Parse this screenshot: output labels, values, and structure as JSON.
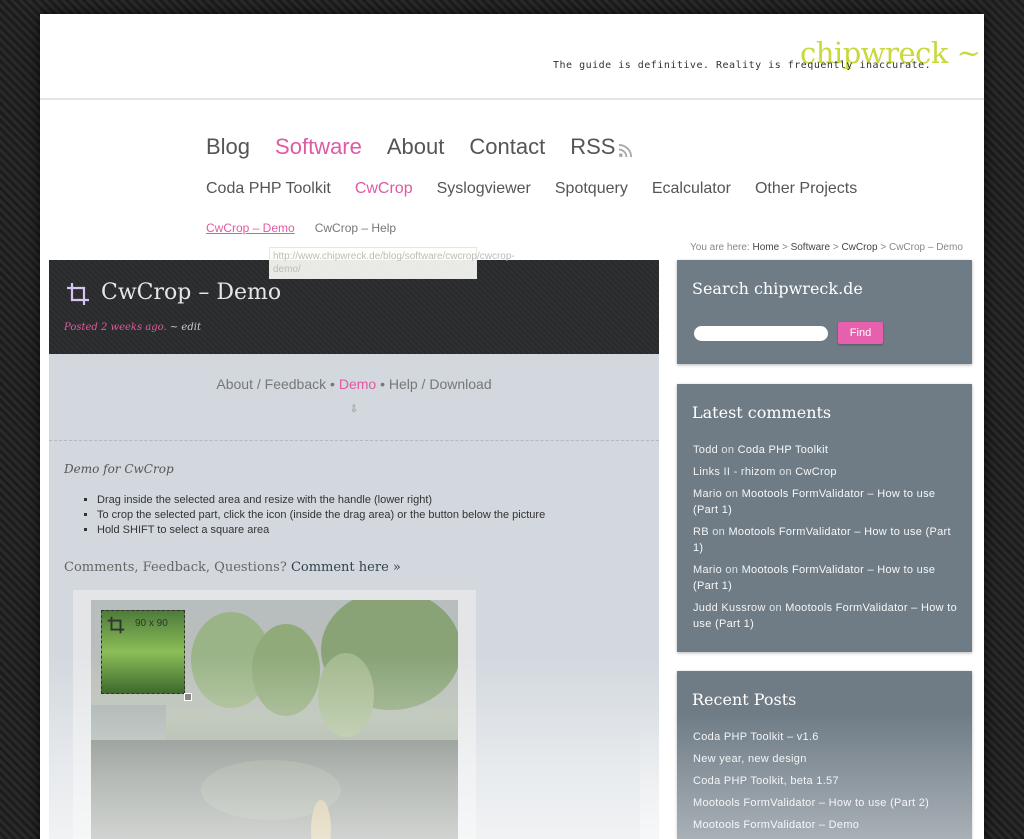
{
  "header": {
    "logo": "chipwreck ~",
    "tagline": "The guide is definitive. Reality is frequently inaccurate."
  },
  "nav": {
    "primary": [
      {
        "label": "Blog"
      },
      {
        "label": "Software",
        "active": true
      },
      {
        "label": "About"
      },
      {
        "label": "Contact"
      },
      {
        "label": "RSS",
        "icon": "rss-icon"
      }
    ],
    "secondary": [
      {
        "label": "Coda PHP Toolkit"
      },
      {
        "label": "CwCrop",
        "active": true
      },
      {
        "label": "Syslogviewer"
      },
      {
        "label": "Spotquery"
      },
      {
        "label": "Ecalculator"
      },
      {
        "label": "Other Projects"
      }
    ],
    "tertiary": [
      {
        "label": "CwCrop – Demo",
        "active": true
      },
      {
        "label": "CwCrop – Help"
      }
    ]
  },
  "tooltip": "http://www.chipwreck.de/blog/software/cwcrop/cwcrop-demo/",
  "breadcrumb": {
    "prefix": "You are here:",
    "items": [
      "Home",
      "Software",
      "CwCrop"
    ],
    "current": "CwCrop – Demo",
    "separator": ">"
  },
  "post": {
    "title": "CwCrop – Demo",
    "posted": "Posted 2 weeks ago.",
    "edit": "~ edit",
    "subnav": {
      "about": "About / Feedback",
      "bullet": "•",
      "demo": "Demo",
      "help": "Help / Download"
    },
    "arrow": "⇩",
    "intro": "Demo for CwCrop",
    "bullets": [
      "Drag inside the selected area and resize with the handle (lower right)",
      "To crop the selected part, click the icon (inside the drag area) or the button below the picture",
      "Hold SHIFT to select a square area"
    ],
    "comments_prompt": "Comments, Feedback, Questions?",
    "comments_link": "Comment here »",
    "crop_size": "90 x 90"
  },
  "sidebar": {
    "search": {
      "title": "Search chipwreck.de",
      "placeholder": "",
      "button": "Find"
    },
    "latest_comments": {
      "title": "Latest comments",
      "connector": "on",
      "items": [
        {
          "author": "Todd",
          "post": "Coda PHP Toolkit"
        },
        {
          "author": "Links II - rhizom",
          "post": "CwCrop"
        },
        {
          "author": "Mario",
          "post": "Mootools FormValidator – How to use (Part 1)"
        },
        {
          "author": "RB",
          "post": "Mootools FormValidator – How to use (Part 1)"
        },
        {
          "author": "Mario",
          "post": "Mootools FormValidator – How to use (Part 1)"
        },
        {
          "author": "Judd Kussrow",
          "post": "Mootools FormValidator – How to use (Part 1)"
        }
      ]
    },
    "recent_posts": {
      "title": "Recent Posts",
      "items": [
        "Coda PHP Toolkit – v1.6",
        "New year, new design",
        "Coda PHP Toolkit, beta 1.57",
        "Mootools FormValidator – How to use (Part 2)",
        "Mootools FormValidator – Demo"
      ]
    }
  },
  "colors": {
    "accent": "#e05aa3",
    "logo": "#c9d83c",
    "sidebox": "#6f7c86",
    "post_header": "#2b2d2f"
  }
}
